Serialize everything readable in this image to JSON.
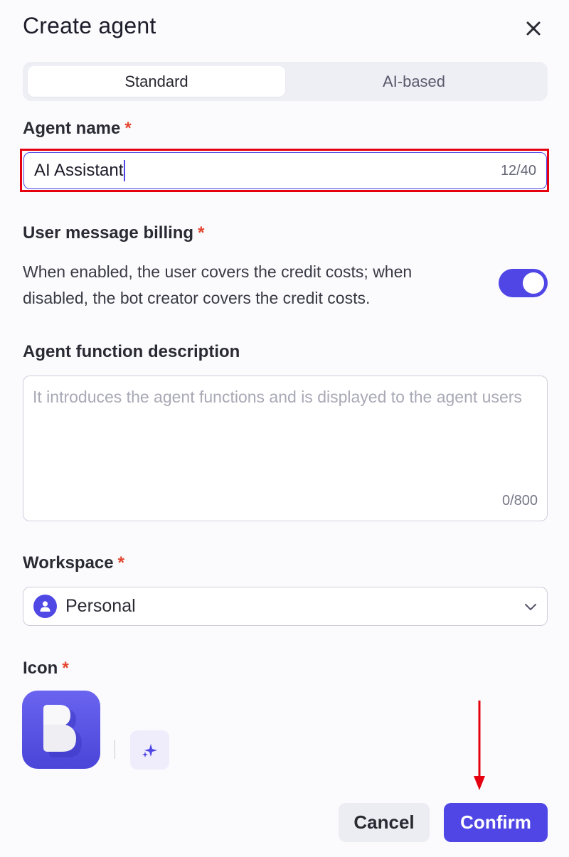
{
  "dialog": {
    "title": "Create agent",
    "close_icon": "close-icon"
  },
  "tabs": [
    {
      "label": "Standard",
      "active": true
    },
    {
      "label": "AI-based",
      "active": false
    }
  ],
  "agent_name": {
    "label": "Agent name",
    "required_mark": "*",
    "value": "AI Assistant",
    "counter": "12/40"
  },
  "billing": {
    "label": "User message billing",
    "required_mark": "*",
    "description": "When enabled, the user covers the credit costs; when disabled, the bot creator covers the credit costs.",
    "enabled": true
  },
  "function_description": {
    "label": "Agent function description",
    "placeholder": "It introduces the agent functions and is displayed to the agent users",
    "counter": "0/800"
  },
  "workspace": {
    "label": "Workspace",
    "required_mark": "*",
    "value": "Personal",
    "avatar_icon": "user-icon",
    "chevron_icon": "chevron-down-icon"
  },
  "icon_field": {
    "label": "Icon",
    "required_mark": "*",
    "generate_icon": "sparkle-icon"
  },
  "footer": {
    "cancel_label": "Cancel",
    "confirm_label": "Confirm"
  },
  "colors": {
    "accent": "#4f46e5",
    "required": "#e3452f",
    "highlight": "#e6000f"
  }
}
